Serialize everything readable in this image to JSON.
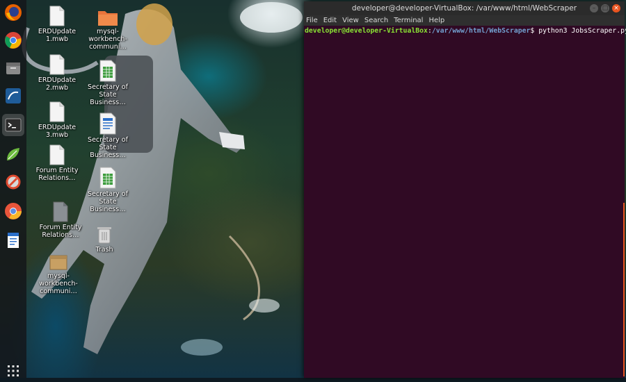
{
  "desktop": {
    "icons": [
      {
        "label": "ERDUpdate 1.mwb",
        "type": "document"
      },
      {
        "label": "ERDUpdate 2.mwb",
        "type": "document"
      },
      {
        "label": "ERDUpdate 3.mwb",
        "type": "document"
      },
      {
        "label": "Forum Entity Relations…",
        "type": "document"
      },
      {
        "label": "Forum Entity Relations…",
        "type": "image"
      },
      {
        "label": "mysql-workbench-communi…",
        "type": "package"
      },
      {
        "label": "mysql-workbench-communi…",
        "type": "folder"
      },
      {
        "label": "Secretary of State Business…",
        "type": "spreadsheet"
      },
      {
        "label": "Secretary of State Business…",
        "type": "text-document"
      },
      {
        "label": "Secretary of State Business…",
        "type": "spreadsheet"
      },
      {
        "label": "Trash",
        "type": "trash"
      }
    ]
  },
  "dock": {
    "items": [
      {
        "name": "firefox-icon"
      },
      {
        "name": "chrome-icon"
      },
      {
        "name": "files-icon"
      },
      {
        "name": "mysql-workbench-icon"
      },
      {
        "name": "terminal-icon",
        "active": true
      },
      {
        "name": "notes-icon"
      },
      {
        "name": "settings-tools-icon"
      },
      {
        "name": "chromium-icon"
      },
      {
        "name": "writer-icon"
      },
      {
        "name": "show-applications-icon"
      }
    ]
  },
  "terminal": {
    "title": "developer@developer-VirtualBox: /var/www/html/WebScraper",
    "menu": [
      "File",
      "Edit",
      "View",
      "Search",
      "Terminal",
      "Help"
    ],
    "prompt_user": "developer@developer-VirtualBox",
    "prompt_sep": ":",
    "prompt_path": "/var/www/html/WebScraper",
    "prompt_symbol": "$ ",
    "command": "python3 JobsScraper.py",
    "controls": {
      "minimize": "–",
      "maximize": "□",
      "close": "×"
    }
  },
  "colors": {
    "terminal_bg": "#300a24",
    "prompt_user": "#8ae234",
    "prompt_path": "#729fcf",
    "close_button": "#e95420"
  }
}
